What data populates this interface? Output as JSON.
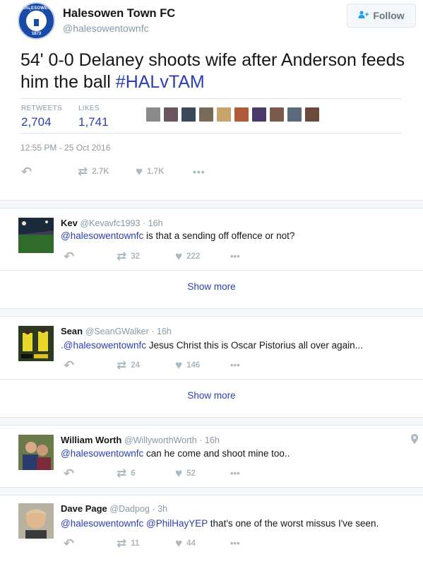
{
  "main": {
    "name": "Halesowen Town FC",
    "handle": "@halesowentownfc",
    "follow_label": "Follow",
    "text": "54' 0-0 Delaney shoots wife after Anderson feeds him the ball ",
    "hashtag": "#HALvTAM",
    "retweets_label": "RETWEETS",
    "retweets": "2,704",
    "likes_label": "LIKES",
    "likes": "1,741",
    "timestamp": "12:55 PM - 25 Oct 2016",
    "retweet_count": "2.7K",
    "like_count": "1.7K",
    "avatar_text": "HALESOWEN TOWN",
    "avatar_year": "1873",
    "liker_colors": [
      "#8a8a8a",
      "#6b5560",
      "#3a4a5c",
      "#7a6a5a",
      "#c9a46a",
      "#b05a3a",
      "#4a3a6a",
      "#7a5a4a",
      "#5a6a7a",
      "#6a4a3a"
    ]
  },
  "replies": [
    {
      "name": "Kev",
      "handle": "@Kevavfc1993",
      "time": "16h",
      "mention": "@halesowentownfc",
      "text": " is that a sending off offence or not?",
      "retweets": "32",
      "likes": "222",
      "show_more": "Show more"
    },
    {
      "name": "Sean",
      "handle": "@SeanGWalker",
      "time": "16h",
      "mention": ".@halesowentownfc",
      "text": " Jesus Christ this is Oscar Pistorius all over again...",
      "retweets": "24",
      "likes": "146",
      "show_more": "Show more"
    },
    {
      "name": "William Worth",
      "handle": "@WillyworthWorth",
      "time": "16h",
      "mention": "@halesowentownfc",
      "text": " can he come and shoot mine too..",
      "retweets": "6",
      "likes": "52"
    },
    {
      "name": "Dave Page",
      "handle": "@Dadpog",
      "time": "3h",
      "mention": "@halesowentownfc",
      "mention2": "@PhilHayYEP",
      "text": " that's one of the worst missus I've seen.",
      "retweets": "11",
      "likes": "44"
    }
  ],
  "icons": {
    "reply": "reply-icon",
    "retweet": "retweet-icon",
    "like": "heart-icon",
    "more": "more-icon",
    "follow": "add-user-icon",
    "location": "location-icon"
  },
  "colors": {
    "link": "#2b3fb3",
    "muted": "#8899a6",
    "icon": "#aab8c2"
  }
}
